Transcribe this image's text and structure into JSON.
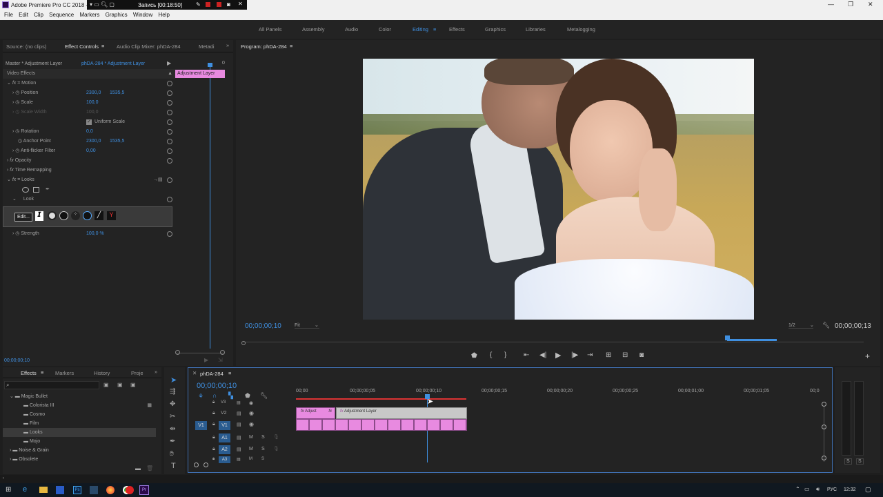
{
  "app": {
    "title": "Adobe Premiere Pro CC 2018 -",
    "recording": "Запись [00:18:50]"
  },
  "menu": [
    "File",
    "Edit",
    "Clip",
    "Sequence",
    "Markers",
    "Graphics",
    "Window",
    "Help"
  ],
  "workspaces": [
    "All Panels",
    "Assembly",
    "Audio",
    "Color",
    "Editing",
    "Effects",
    "Graphics",
    "Libraries",
    "Metalogging"
  ],
  "active_workspace": "Editing",
  "source_tabs": {
    "source": "Source: (no clips)",
    "effect_controls": "Effect Controls",
    "audio_mixer": "Audio Clip Mixer: phDA-284",
    "metadata": "Metadi"
  },
  "effect_controls": {
    "master": "Master * Adjustment Layer",
    "clip": "phDA-284 * Adjustment Layer",
    "timeline_zero": "0",
    "clip_bar": "Adjustment Layer",
    "video_effects": "Video Effects",
    "motion": "Motion",
    "position": {
      "label": "Position",
      "x": "2300,0",
      "y": "1535,5"
    },
    "scale": {
      "label": "Scale",
      "value": "100,0"
    },
    "scale_width": {
      "label": "Scale Width",
      "value": "100,0"
    },
    "uniform_scale": "Uniform Scale",
    "rotation": {
      "label": "Rotation",
      "value": "0,0"
    },
    "anchor": {
      "label": "Anchor Point",
      "x": "2300,0",
      "y": "1535,5"
    },
    "anti_flicker": {
      "label": "Anti-flicker Filter",
      "value": "0,00"
    },
    "opacity": "Opacity",
    "time_remapping": "Time Remapping",
    "looks": "Looks",
    "look": "Look",
    "edit_button": "Edit...",
    "strength": {
      "label": "Strength",
      "value": "100,0 %"
    },
    "timecode": "00;00;00;10"
  },
  "program": {
    "title": "Program: phDA-284",
    "timecode_left": "00;00;00;10",
    "fit": "Fit",
    "resolution": "1/2",
    "timecode_right": "00;00;00;13",
    "colors": {
      "sky": "#c8dce4",
      "field": "#a49048",
      "suit": "#2e3238",
      "skin": "#dcb098",
      "dress": "#eef2fa",
      "hair": "#4a3224"
    }
  },
  "effects_panel": {
    "tabs": [
      "Effects",
      "Markers",
      "History",
      "Proje"
    ],
    "items": [
      {
        "label": "Magic Bullet",
        "level": 1
      },
      {
        "label": "Colorista III",
        "level": 2
      },
      {
        "label": "Cosmo",
        "level": 2
      },
      {
        "label": "Film",
        "level": 2
      },
      {
        "label": "Looks",
        "level": 2
      },
      {
        "label": "Mojo",
        "level": 2
      },
      {
        "label": "Noise & Grain",
        "level": 1
      },
      {
        "label": "Obsolete",
        "level": 1
      }
    ]
  },
  "timeline": {
    "tab": "phDA-284",
    "timecode": "00;00;00;10",
    "ruler": [
      "00;00",
      "00;00;00;05",
      "00;00;00;10",
      "00;00;00;15",
      "00;00;00;20",
      "00;00;00;25",
      "00;00;01;00",
      "00;00;01;05",
      "00;0"
    ],
    "tracks": [
      "V3",
      "V2",
      "V1",
      "A1",
      "A2",
      "A3"
    ],
    "source_patch_v": "V1",
    "clip_short": "Adjust",
    "clip_long": "Adjustment Layer",
    "mute": "M",
    "solo": "S"
  },
  "meter": {
    "s_left": "S",
    "s_right": "S"
  },
  "taskbar": {
    "lang": "РУС",
    "time": "12:32"
  }
}
